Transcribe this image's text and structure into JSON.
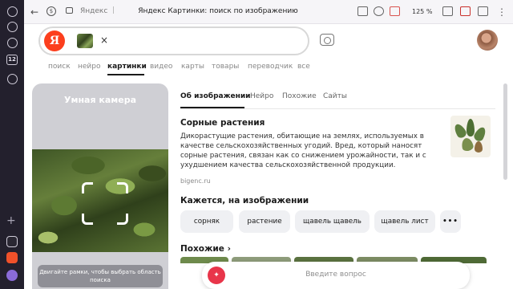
{
  "browser": {
    "domain": "Яндекс",
    "page_title": "Яндекс Картинки: поиск по изображению",
    "zoom": "125 %"
  },
  "search": {
    "logo": "Я",
    "clear_symbol": "×"
  },
  "nav": {
    "items": [
      "поиск",
      "нейро",
      "картинки",
      "видео",
      "карты",
      "товары",
      "переводчик",
      "все"
    ],
    "active": "картинки"
  },
  "smart_camera": {
    "title": "Умная камера",
    "hint": "Двигайте рамки, чтобы выбрать область поиска"
  },
  "info": {
    "tabs": [
      "Об изображении",
      "Нейро",
      "Похожие",
      "Сайты"
    ],
    "active_tab": "Об изображении",
    "heading": "Сорные растения",
    "description": "Дикорастущие растения, обитающие на землях, используемых в качестве сельскохозяйственных угодий. Вред, который наносят сорные растения, связан как со снижением урожайности, так и с ухудшением качества сельскохозяйственной продукции.",
    "source": "bigenc.ru",
    "seems_heading": "Кажется, на изображении",
    "chips": [
      "сорняк",
      "растение",
      "щавель щавель",
      "щавель лист"
    ],
    "more": "•••",
    "similar_heading": "Похожие",
    "similar_arrow": "›"
  },
  "ask": {
    "placeholder": "Введите вопрос"
  },
  "colors": {
    "yandex_red": "#fc3f1d",
    "rail_bg": "#23202d",
    "chip_bg": "#eff0f3"
  }
}
